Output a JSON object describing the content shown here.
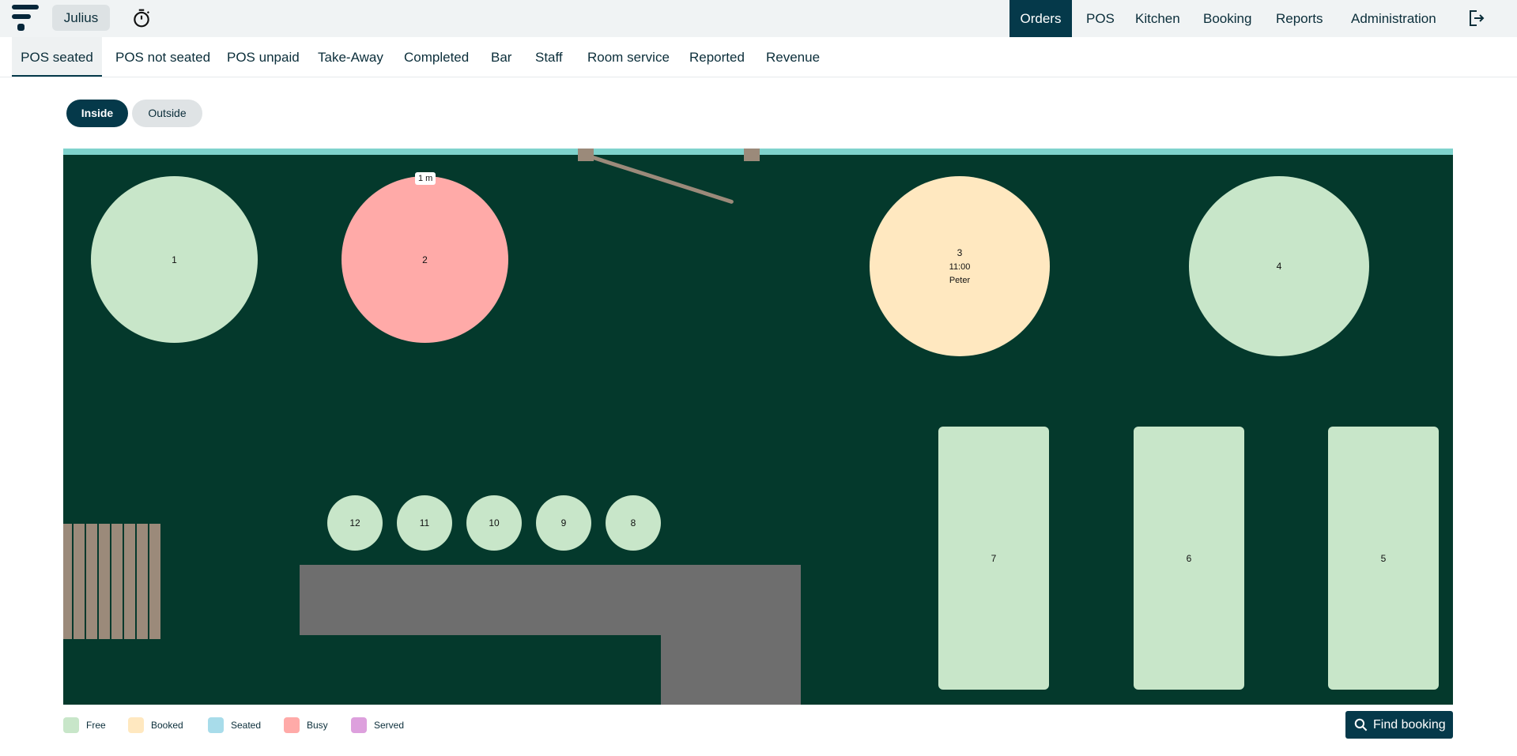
{
  "header": {
    "user": "Julius",
    "nav": [
      "Orders",
      "POS",
      "Kitchen",
      "Booking",
      "Reports",
      "Administration"
    ]
  },
  "tabs": [
    "POS seated",
    "POS not seated",
    "POS unpaid",
    "Take-Away",
    "Completed",
    "Bar",
    "Staff",
    "Room service",
    "Reported",
    "Revenue"
  ],
  "areas": [
    "Inside",
    "Outside"
  ],
  "floor": {
    "scale_label": "1 m",
    "tables": [
      {
        "number": "1",
        "status": "free"
      },
      {
        "number": "2",
        "status": "busy"
      },
      {
        "number": "3",
        "status": "booked",
        "time": "11:00",
        "guest": "Peter"
      },
      {
        "number": "4",
        "status": "free"
      },
      {
        "number": "5",
        "status": "free"
      },
      {
        "number": "6",
        "status": "free"
      },
      {
        "number": "7",
        "status": "free"
      },
      {
        "number": "8",
        "status": "free"
      },
      {
        "number": "9",
        "status": "free"
      },
      {
        "number": "10",
        "status": "free"
      },
      {
        "number": "11",
        "status": "free"
      },
      {
        "number": "12",
        "status": "free"
      }
    ]
  },
  "legend": [
    {
      "label": "Free",
      "color": "#c8e6c9"
    },
    {
      "label": "Booked",
      "color": "#ffe8c0"
    },
    {
      "label": "Seated",
      "color": "#a8dcea"
    },
    {
      "label": "Busy",
      "color": "#ffaaa8"
    },
    {
      "label": "Served",
      "color": "#dda0dd"
    }
  ],
  "find_booking_label": "Find booking",
  "icons": {
    "timer": "stopwatch-icon",
    "logout": "logout-icon",
    "search": "search-icon"
  }
}
